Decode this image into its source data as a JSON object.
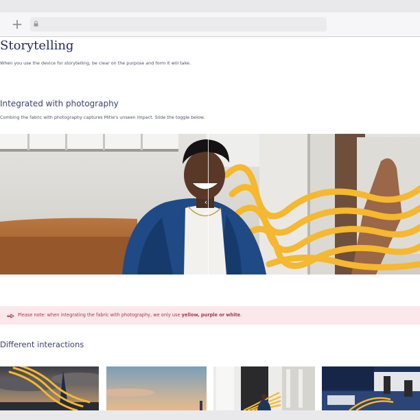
{
  "page": {
    "title": "Storytelling",
    "intro": "When you use the device for storytelling, be clear on the purpose and form it will take."
  },
  "section": {
    "heading": "Integrated with photography",
    "description": "Combing the fabric with photography captures Mitie's unseen impact. Slide the toggle below."
  },
  "slider": {
    "handle_glyph": "‹ ›",
    "position": 0.495
  },
  "note": {
    "text_prefix": "Please note: when integrating the fabric with photography, we only use ",
    "highlight": "yellow, purple or white",
    "text_suffix": "."
  },
  "interactions": {
    "heading": "Different interactions"
  },
  "colors": {
    "brand_navy": "#232a56",
    "fabric_yellow": "#f5b82e",
    "note_background": "#fbe8ea",
    "note_text": "#9c3c48"
  },
  "icons": {
    "new_tab": "+",
    "lock": "lock-icon",
    "note": "hand-pointer-icon"
  }
}
